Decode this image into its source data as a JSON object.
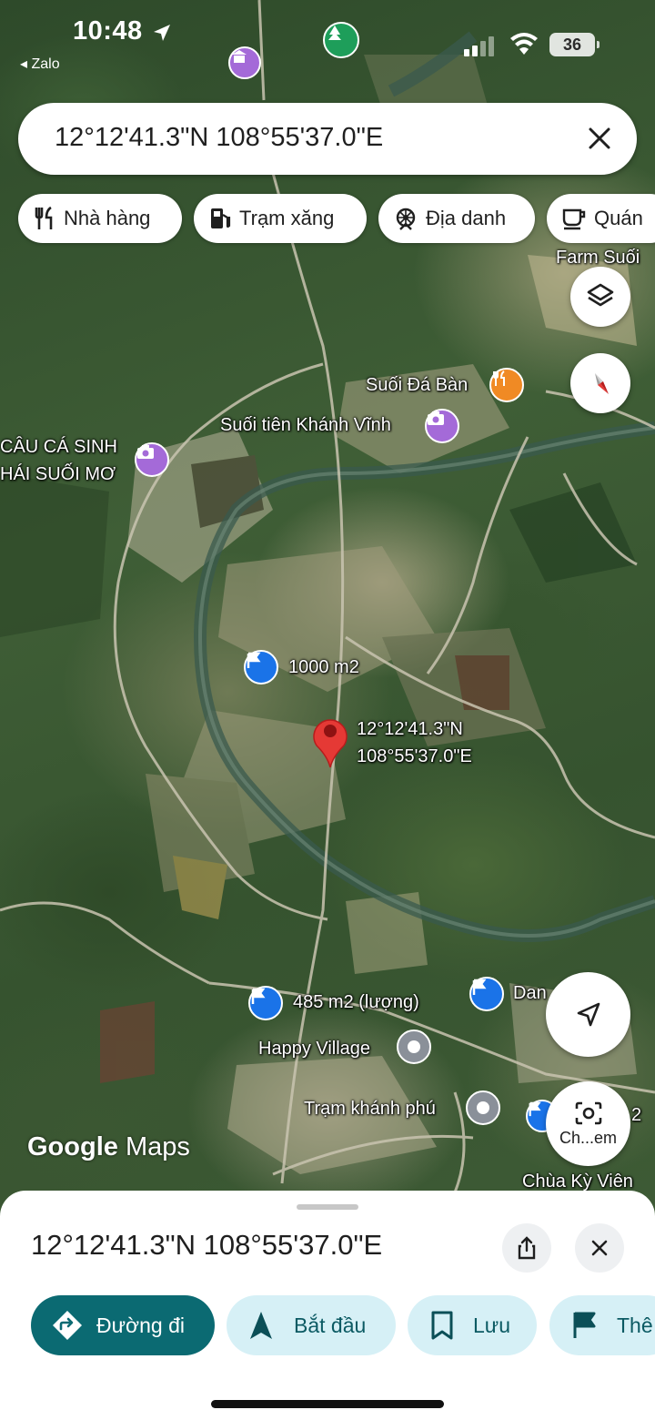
{
  "status_bar": {
    "time": "10:48",
    "back_app": "Zalo",
    "battery": "36"
  },
  "search": {
    "query": "12°12'41.3\"N 108°55'37.0\"E"
  },
  "chips": [
    {
      "label": "Nhà hàng",
      "icon": "restaurant-icon"
    },
    {
      "label": "Trạm xăng",
      "icon": "gas-station-icon"
    },
    {
      "label": "Địa danh",
      "icon": "landmark-icon"
    },
    {
      "label": "Quán",
      "icon": "cafe-icon"
    }
  ],
  "map": {
    "labels": {
      "farm": "Farm Suối",
      "suoi_da_ban": "Suối Đá Bàn",
      "suoi_tien": "Suối tiên Khánh Vĩnh",
      "cau_ca_line1": "CÂU CÁ SINH",
      "cau_ca_line2": "HÁI SUỐI MƠ",
      "plot_1000": "1000 m2",
      "pin_line1": "12°12'41.3\"N",
      "pin_line2": "108°55'37.0\"E",
      "plot_485": "485 m2 (lượng)",
      "dan": "Dan",
      "happy_village": "Happy Village",
      "tram_khanh_phu": "Trạm khánh phú",
      "chua_ky_vien": "Chùa Kỳ Viên",
      "partial_2": "2"
    },
    "lens_label": "Ch...em",
    "attribution_google": "Google",
    "attribution_maps": "Maps",
    "colors": {
      "pin": "#e53935",
      "poi_purple": "#a46ad8",
      "poi_orange": "#f08a24",
      "poi_green": "#1e9e5a",
      "flag_blue": "#1a73e8",
      "poi_gray": "#8a9099"
    }
  },
  "sheet": {
    "title": "12°12'41.3\"N 108°55'37.0\"E",
    "actions": [
      {
        "label": "Đường đi",
        "icon": "directions-icon"
      },
      {
        "label": "Bắt đầu",
        "icon": "navigation-arrow-icon"
      },
      {
        "label": "Lưu",
        "icon": "bookmark-icon"
      },
      {
        "label": "Thê",
        "icon": "flag-icon"
      }
    ]
  }
}
